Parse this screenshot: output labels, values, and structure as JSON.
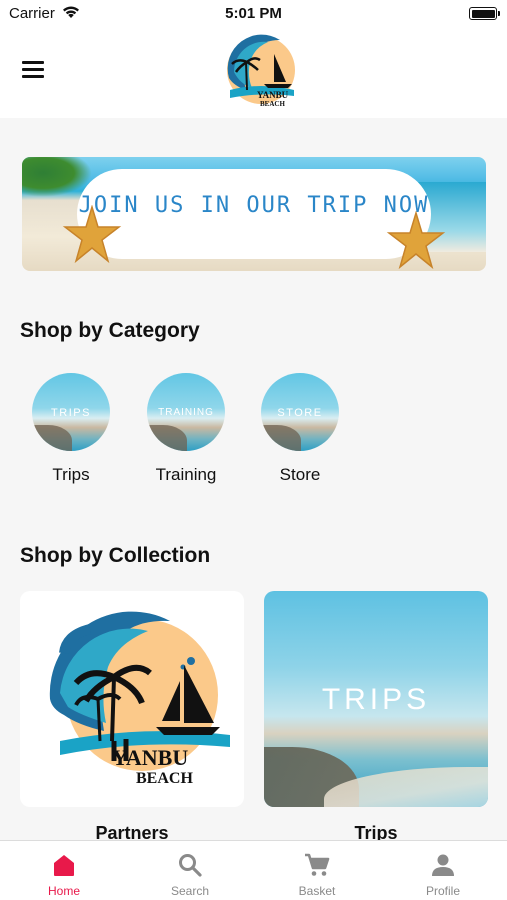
{
  "status_bar": {
    "carrier": "Carrier",
    "time": "5:01 PM"
  },
  "header": {
    "logo_text_line1": "YANBU",
    "logo_text_line2": "BEACH"
  },
  "banner": {
    "text": "JOIN US IN OUR TRIP NOW"
  },
  "categories": {
    "title": "Shop by Category",
    "items": [
      {
        "image_text": "TRIPS",
        "label": "Trips"
      },
      {
        "image_text": "TRAINING",
        "label": "Training"
      },
      {
        "image_text": "STORE",
        "label": "Store"
      }
    ]
  },
  "collections": {
    "title": "Shop by Collection",
    "items": [
      {
        "label": "Partners",
        "logo_line1": "YANBU",
        "logo_line2": "BEACH"
      },
      {
        "label": "Trips",
        "image_text": "TRIPS"
      }
    ]
  },
  "tabbar": {
    "active_color": "#e8194a",
    "inactive_color": "#8a8a8a",
    "items": [
      {
        "label": "Home",
        "icon": "home-icon",
        "active": true
      },
      {
        "label": "Search",
        "icon": "search-icon",
        "active": false
      },
      {
        "label": "Basket",
        "icon": "cart-icon",
        "active": false
      },
      {
        "label": "Profile",
        "icon": "person-icon",
        "active": false
      }
    ]
  }
}
